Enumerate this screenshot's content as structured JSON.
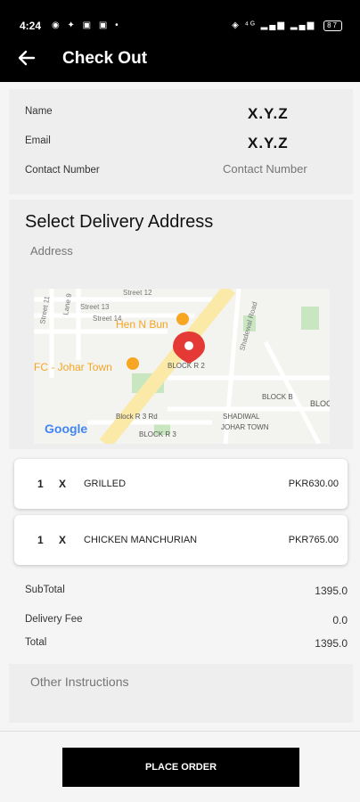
{
  "status_bar": {
    "time": "4:24",
    "notification_icons": "◉ ✦ ▣ ▣ •",
    "system_icons": "◈ ⁴ᴳ ▂▄▆ ▂▄▆",
    "battery": "87"
  },
  "app_bar": {
    "back_icon": "arrow-left",
    "title": "Check Out"
  },
  "contact": {
    "name_label": "Name",
    "name_value": "X.Y.Z",
    "email_label": "Email",
    "email_value": "X.Y.Z",
    "phone_label": "Contact Number",
    "phone_placeholder": "Contact Number"
  },
  "address": {
    "heading": "Select Delivery Address",
    "placeholder": "Address",
    "map": {
      "labels": {
        "street12": "Street 12",
        "street13": "Street 13",
        "street14": "Street 14",
        "street11": "Street 11",
        "lane9": "Lane 9",
        "place_hen": "Hen N Bun",
        "place_kfc": "FC - Johar Town",
        "block_r2": "BLOCK R 2",
        "block_b": "BLOCK B",
        "block_c": "BLOC C ك",
        "block_r3_rd": "Block R 3 Rd",
        "block_r3": "BLOCK R 3",
        "shadiwal": "SHADIWAL",
        "johar_town": "JOHAR TOWN",
        "shadiwal_road": "Shadewal Road",
        "google": "Google"
      },
      "colors": {
        "base": "#f3f3ef",
        "main_road": "#fbe9a8",
        "park": "#c8e6c0",
        "pin": "#e53935",
        "poi": "#f6a623"
      }
    }
  },
  "order": {
    "items": [
      {
        "qty": "1",
        "x": "X",
        "name": "GRILLED",
        "price": "PKR630.00"
      },
      {
        "qty": "1",
        "x": "X",
        "name": "CHICKEN MANCHURIAN",
        "price": "PKR765.00"
      }
    ]
  },
  "summary": {
    "subtotal_label": "SubTotal",
    "subtotal_value": "1395.0",
    "delivery_label": "Delivery Fee",
    "delivery_value": "0.0",
    "total_label": "Total",
    "total_value": "1395.0"
  },
  "instructions": {
    "placeholder": "Other Instructions"
  },
  "place_order_label": "PLACE ORDER"
}
